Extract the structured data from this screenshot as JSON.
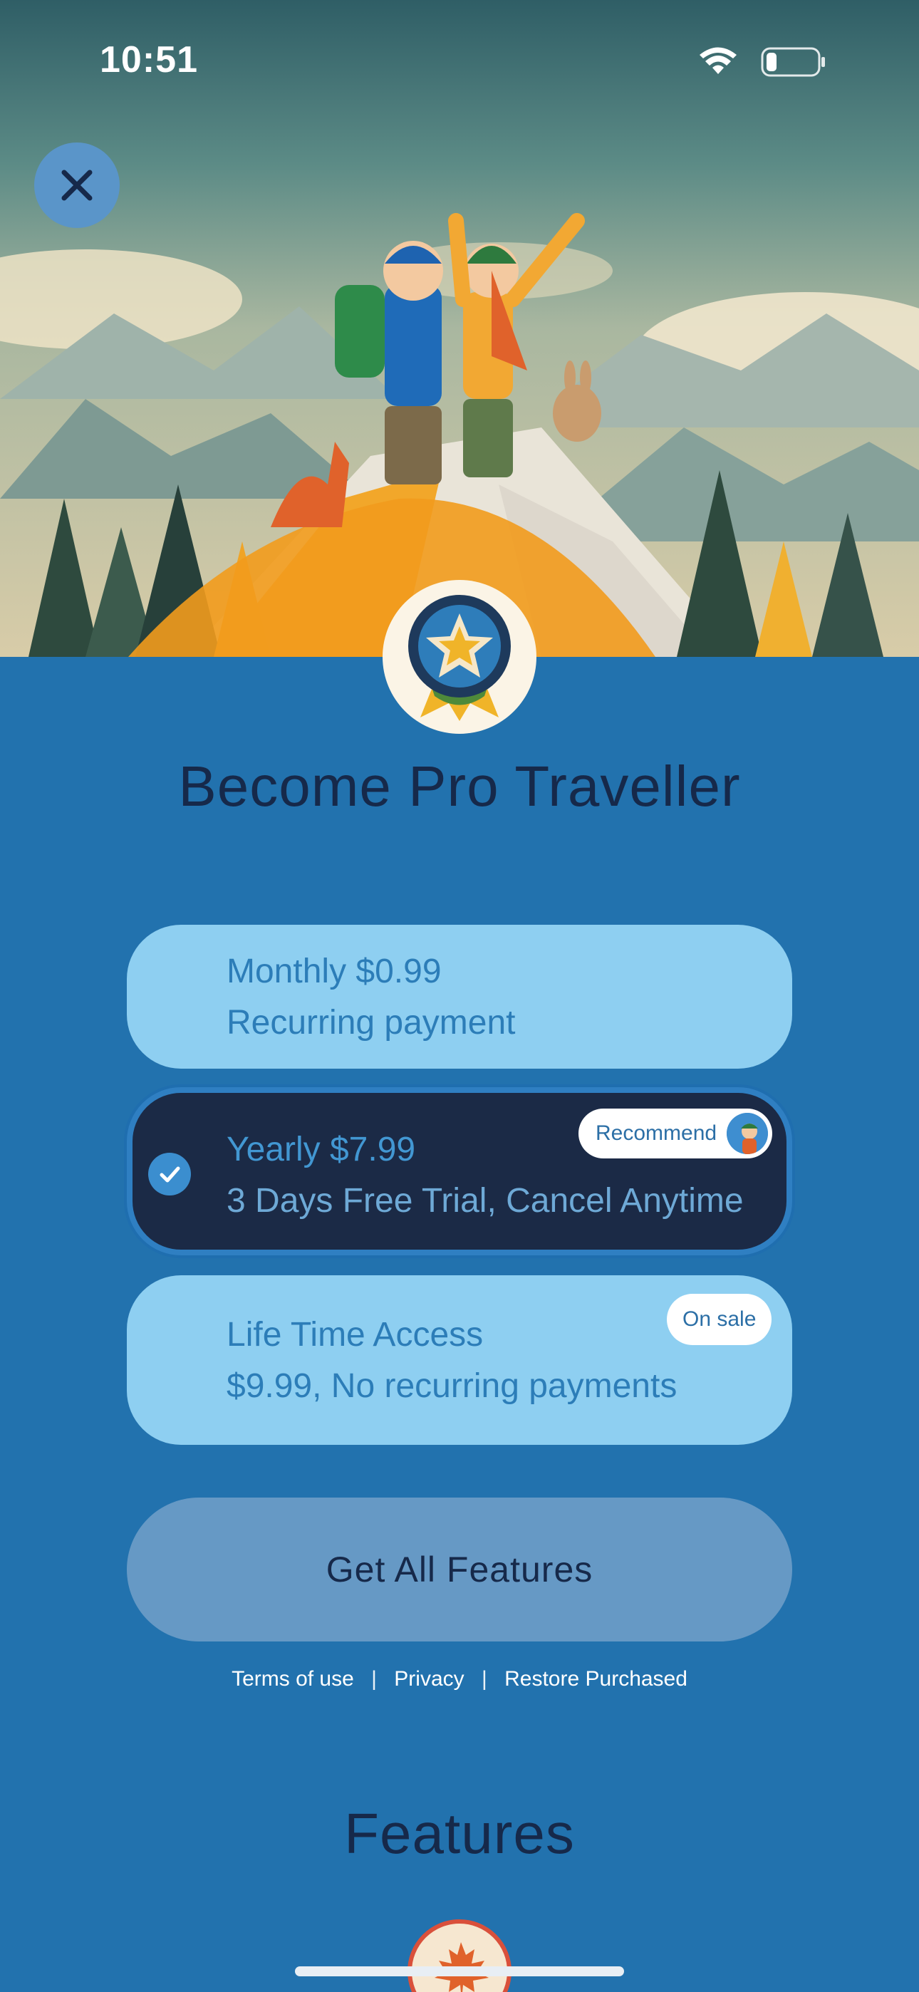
{
  "status_bar": {
    "time": "10:51"
  },
  "header": {
    "title": "Become Pro Traveller"
  },
  "plans": [
    {
      "line1": "Monthly $0.99",
      "line2": "Recurring payment",
      "selected": false
    },
    {
      "line1": "Yearly $7.99",
      "line2": "3 Days Free Trial, Cancel Anytime",
      "selected": true,
      "tag": "Recommend"
    },
    {
      "line1": "Life Time Access",
      "line2": "$9.99, No recurring payments",
      "selected": false,
      "tag": "On sale"
    }
  ],
  "cta": {
    "label": "Get All Features"
  },
  "links": {
    "terms": "Terms of use",
    "privacy": "Privacy",
    "restore": "Restore Purchased",
    "separator": "|"
  },
  "features": {
    "title": "Features"
  },
  "colors": {
    "background": "#2272AE",
    "plan_card": "#8ECFF1",
    "selected_card": "#1B2A46",
    "cta": "#6699C5",
    "title_text": "#16294A"
  },
  "icons": [
    "wifi-icon",
    "battery-icon",
    "close-icon",
    "pro-badge-icon",
    "check-icon",
    "maple-leaf-icon"
  ]
}
